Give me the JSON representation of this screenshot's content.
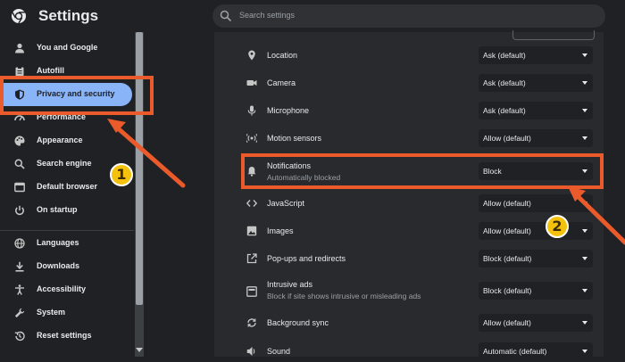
{
  "header": {
    "title": "Settings",
    "logo_icon": "chrome-logo-icon"
  },
  "search": {
    "placeholder": "Search settings",
    "icon": "search-icon"
  },
  "sidebar": {
    "items": [
      {
        "label": "You and Google",
        "icon": "person-icon"
      },
      {
        "label": "Autofill",
        "icon": "clipboard-icon"
      },
      {
        "label": "Privacy and security",
        "icon": "shield-icon",
        "active": true
      },
      {
        "label": "Performance",
        "icon": "gauge-icon"
      },
      {
        "label": "Appearance",
        "icon": "palette-icon"
      },
      {
        "label": "Search engine",
        "icon": "search-icon"
      },
      {
        "label": "Default browser",
        "icon": "browser-icon"
      },
      {
        "label": "On startup",
        "icon": "power-icon"
      },
      {
        "label": "Languages",
        "icon": "globe-icon"
      },
      {
        "label": "Downloads",
        "icon": "download-icon"
      },
      {
        "label": "Accessibility",
        "icon": "accessibility-icon"
      },
      {
        "label": "System",
        "icon": "wrench-icon"
      },
      {
        "label": "Reset settings",
        "icon": "history-icon"
      }
    ]
  },
  "permissions": {
    "rows": [
      {
        "label": "Location",
        "value": "Ask (default)",
        "icon": "location-pin-icon"
      },
      {
        "label": "Camera",
        "value": "Ask (default)",
        "icon": "camera-icon"
      },
      {
        "label": "Microphone",
        "value": "Ask (default)",
        "icon": "microphone-icon"
      },
      {
        "label": "Motion sensors",
        "value": "Allow (default)",
        "icon": "sensors-icon"
      },
      {
        "label": "Notifications",
        "sub": "Automatically blocked",
        "value": "Block",
        "icon": "bell-icon"
      },
      {
        "label": "JavaScript",
        "value": "Allow (default)",
        "icon": "code-icon"
      },
      {
        "label": "Images",
        "value": "Allow (default)",
        "icon": "image-icon"
      },
      {
        "label": "Pop-ups and redirects",
        "value": "Block (default)",
        "icon": "external-link-icon"
      },
      {
        "label": "Intrusive ads",
        "sub": "Block if site shows intrusive or misleading ads",
        "value": "Block (default)",
        "icon": "ads-icon"
      },
      {
        "label": "Background sync",
        "value": "Allow (default)",
        "icon": "sync-icon"
      },
      {
        "label": "Sound",
        "value": "Automatic (default)",
        "icon": "speaker-icon"
      }
    ]
  },
  "annotations": {
    "badge_1": "1",
    "badge_2": "2",
    "highlight_color": "#ea5a2b",
    "badge_color": "#f4c20d"
  },
  "colors": {
    "accent": "#8ab4f8",
    "background": "#202124",
    "panel": "#292a2d"
  }
}
